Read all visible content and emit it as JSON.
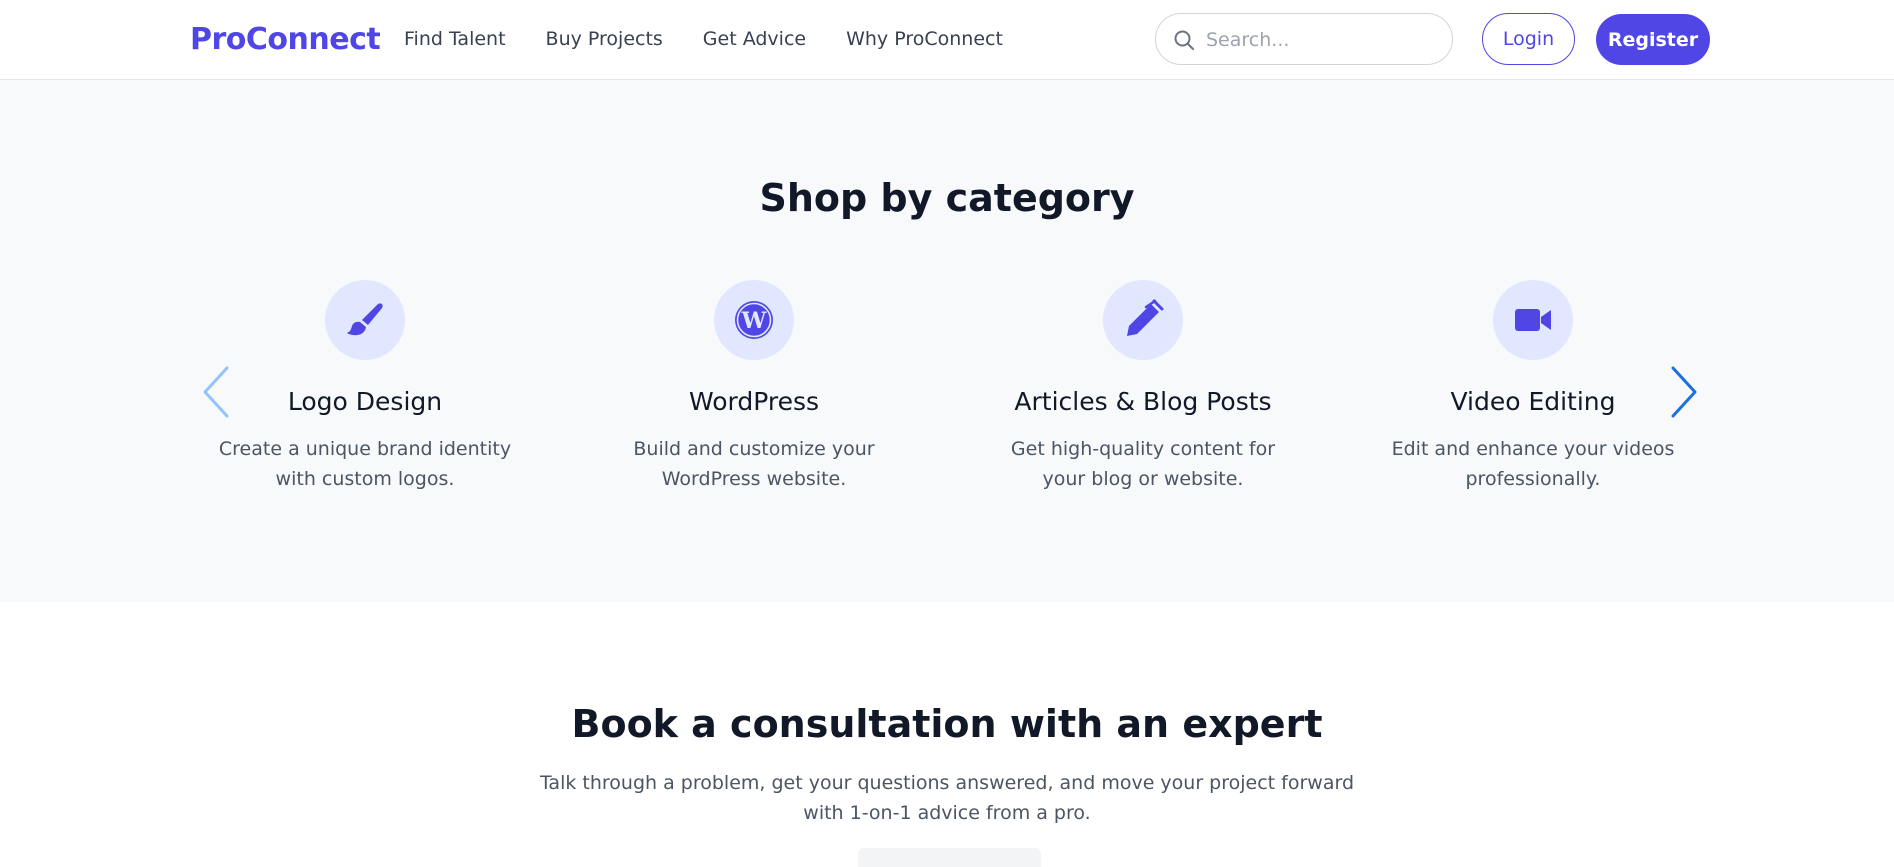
{
  "header": {
    "brand": "ProConnect",
    "nav": [
      "Find Talent",
      "Buy Projects",
      "Get Advice",
      "Why ProConnect"
    ],
    "search_placeholder": "Search...",
    "login_label": "Login",
    "register_label": "Register"
  },
  "categories": {
    "title": "Shop by category",
    "items": [
      {
        "title": "Logo Design",
        "description": "Create a unique brand identity with custom logos.",
        "icon": "paint-brush-icon"
      },
      {
        "title": "WordPress",
        "description": "Build and customize your WordPress website.",
        "icon": "wordpress-icon"
      },
      {
        "title": "Articles & Blog Posts",
        "description": "Get high-quality content for your blog or website.",
        "icon": "pen-icon"
      },
      {
        "title": "Video Editing",
        "description": "Edit and enhance your videos professionally.",
        "icon": "video-camera-icon"
      }
    ]
  },
  "consultation": {
    "title": "Book a consultation with an expert",
    "description": "Talk through a problem, get your questions answered, and move your project forward with 1-on-1 advice from a pro."
  },
  "colors": {
    "brand": "#4f46e5",
    "icon_bg": "#e0e7ff",
    "section_bg": "#f8f9fb",
    "arrow_disabled": "#93c5fd",
    "arrow_active": "#1d6fe0"
  }
}
